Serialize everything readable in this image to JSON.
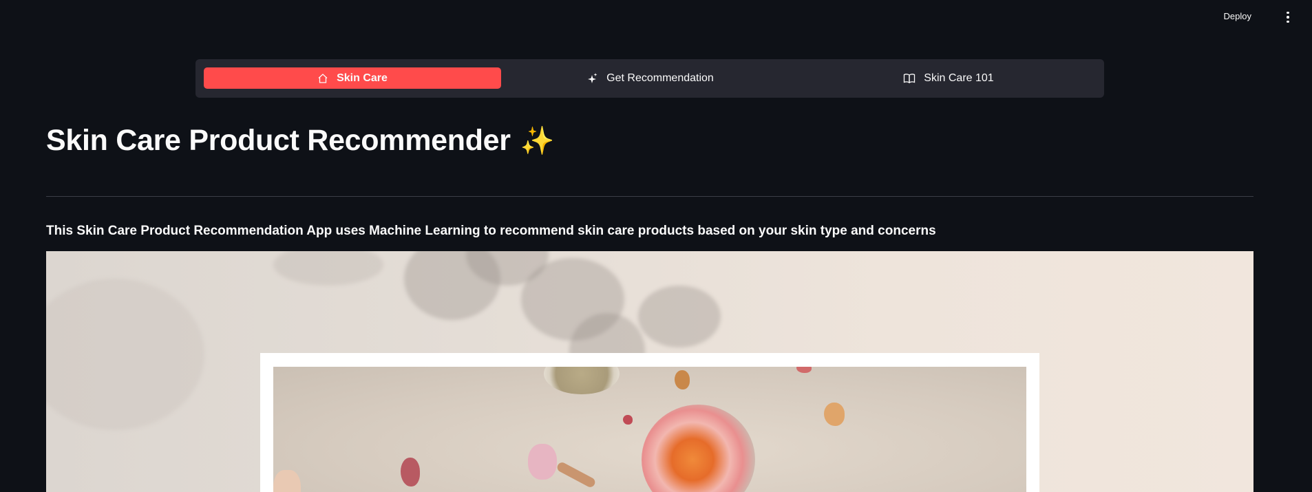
{
  "header": {
    "deploy_label": "Deploy"
  },
  "nav": {
    "items": [
      {
        "label": "Skin Care",
        "icon": "house-icon",
        "active": true
      },
      {
        "label": "Get Recommendation",
        "icon": "sparkles-icon",
        "active": false
      },
      {
        "label": "Skin Care 101",
        "icon": "book-icon",
        "active": false
      }
    ],
    "active_color": "#ff4b4b",
    "bar_color": "#262730"
  },
  "main": {
    "title": "Skin Care Product Recommender",
    "title_emoji": "✨",
    "description": "This Skin Care Product Recommendation App uses Machine Learning to recommend skin care products based on your skin type and concerns"
  },
  "colors": {
    "background": "#0e1117",
    "text": "#fafafa"
  }
}
